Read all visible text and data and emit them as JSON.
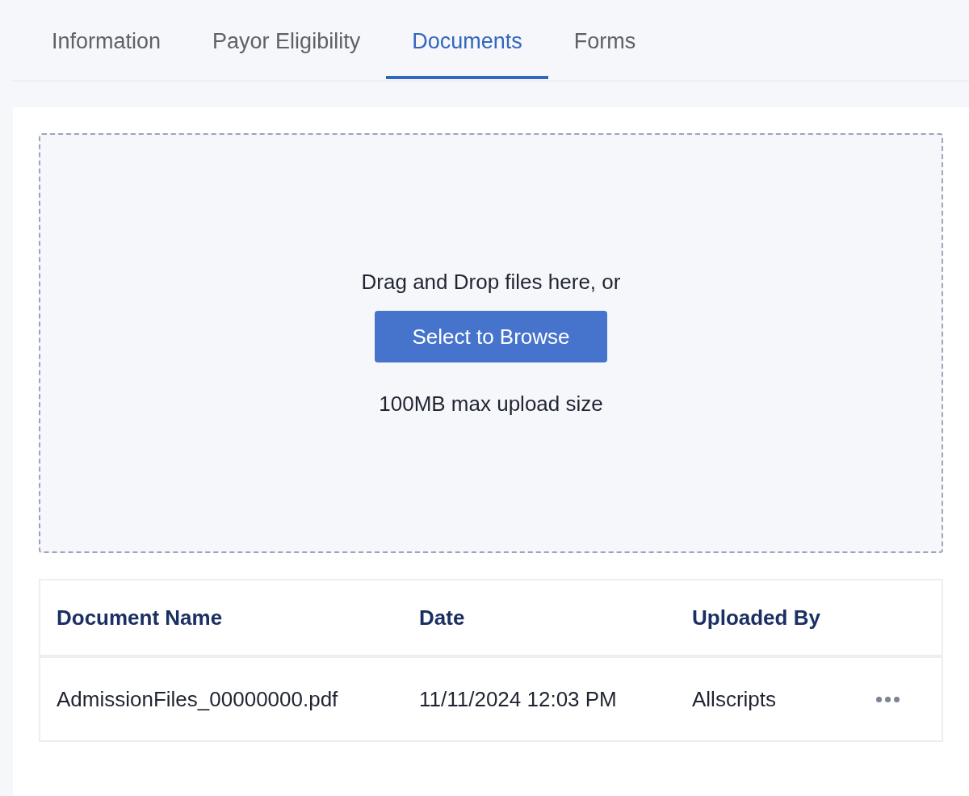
{
  "tabs": [
    {
      "label": "Information",
      "selected": false
    },
    {
      "label": "Payor Eligibility",
      "selected": false
    },
    {
      "label": "Documents",
      "selected": true
    },
    {
      "label": "Forms",
      "selected": false
    }
  ],
  "dropzone": {
    "prompt": "Drag and Drop files here, or",
    "button": "Select to Browse",
    "limit": "100MB max upload size"
  },
  "table": {
    "columns": [
      "Document Name",
      "Date",
      "Uploaded By"
    ],
    "rows": [
      {
        "cells": [
          "AdmissionFiles_00000000.pdf",
          "11/11/2024 12:03 PM",
          "Allscripts"
        ]
      }
    ]
  }
}
